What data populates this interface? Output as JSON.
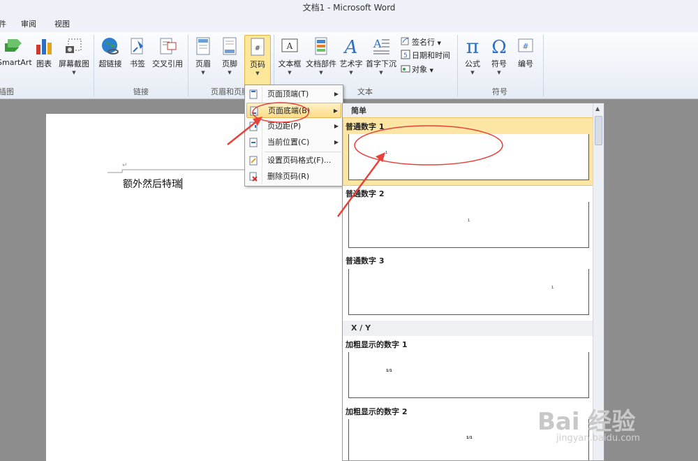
{
  "window": {
    "title": "文档1 - Microsoft Word"
  },
  "tabs": [
    "件",
    "审阅",
    "视图"
  ],
  "ribbon": {
    "groups": {
      "illustrations": "插图",
      "links": "链接",
      "header_footer": "页眉和页脚",
      "text": "文本",
      "symbols": "符号"
    },
    "buttons": {
      "smartart": "SmartArt",
      "chart": "图表",
      "screenshot": "屏幕截图",
      "hyperlink": "超链接",
      "bookmark": "书签",
      "cross_ref": "交叉引用",
      "header": "页眉",
      "footer": "页脚",
      "page_number": "页码",
      "textbox": "文本框",
      "quick_parts": "文档部件",
      "wordart": "艺术字",
      "drop_cap": "首字下沉",
      "equation": "公式",
      "symbol": "符号",
      "number": "编号"
    },
    "small": {
      "signature": "签名行",
      "datetime": "日期和时间",
      "object": "对象"
    }
  },
  "document": {
    "text": "额外然后特瑞"
  },
  "menu": {
    "items": [
      {
        "label": "页面顶端(T)",
        "submenu": true
      },
      {
        "label": "页面底端(B)",
        "submenu": true
      },
      {
        "label": "页边距(P)",
        "submenu": true
      },
      {
        "label": "当前位置(C)",
        "submenu": true
      },
      {
        "label": "设置页码格式(F)...",
        "submenu": false
      },
      {
        "label": "删除页码(R)",
        "submenu": false
      }
    ]
  },
  "gallery": {
    "categories": [
      "简单",
      "X / Y"
    ],
    "items": [
      {
        "title": "普通数字 1",
        "sample": "1"
      },
      {
        "title": "普通数字 2",
        "sample": "1"
      },
      {
        "title": "普通数字 3",
        "sample": "1"
      },
      {
        "title": "加粗显示的数字 1",
        "sample": "1/1"
      },
      {
        "title": "加粗显示的数字 2",
        "sample": "1/1"
      }
    ]
  },
  "watermark": {
    "brand": "Bai 经验",
    "url": "jingyan.baidu.com"
  },
  "colors": {
    "highlight": "#fde6a4",
    "annotation": "#e8413a",
    "ribbon": "#eef2f8"
  }
}
